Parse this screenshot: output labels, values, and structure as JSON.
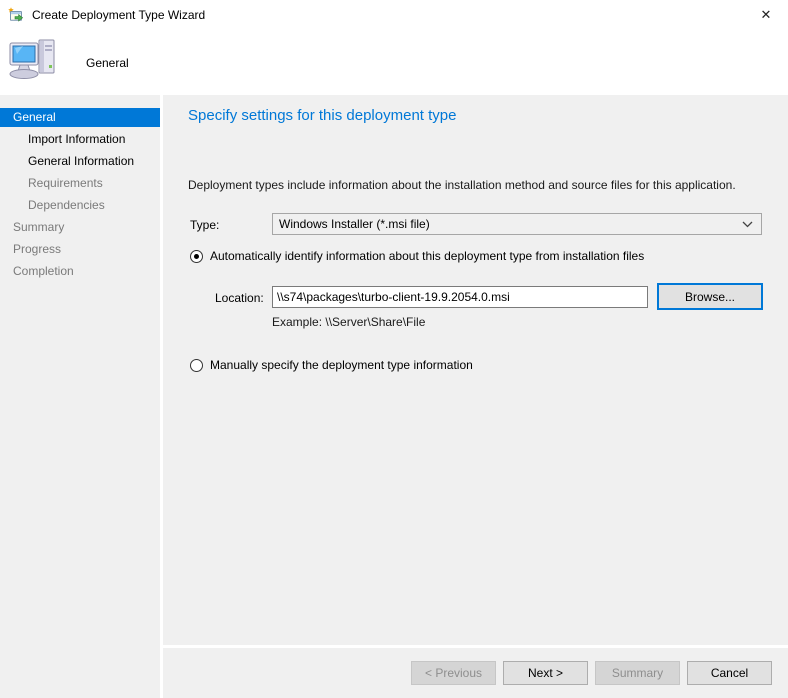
{
  "window": {
    "title": "Create Deployment Type Wizard",
    "close_glyph": "✕"
  },
  "banner": {
    "page_label": "General"
  },
  "sidebar": {
    "items": [
      {
        "label": "General",
        "state": "selected",
        "indent": false
      },
      {
        "label": "Import Information",
        "state": "enabled",
        "indent": true
      },
      {
        "label": "General Information",
        "state": "enabled",
        "indent": true
      },
      {
        "label": "Requirements",
        "state": "disabled",
        "indent": true
      },
      {
        "label": "Dependencies",
        "state": "disabled",
        "indent": true
      },
      {
        "label": "Summary",
        "state": "disabled",
        "indent": false
      },
      {
        "label": "Progress",
        "state": "disabled",
        "indent": false
      },
      {
        "label": "Completion",
        "state": "disabled",
        "indent": false
      }
    ]
  },
  "content": {
    "heading": "Specify settings for this deployment type",
    "description": "Deployment types include information about the installation method and source files for this application.",
    "type_label": "Type:",
    "type_value": "Windows Installer (*.msi file)",
    "auto_radio_label": "Automatically identify information about this deployment type from installation files",
    "auto_radio_selected": true,
    "location_label": "Location:",
    "location_value": "\\\\s74\\packages\\turbo-client-19.9.2054.0.msi",
    "browse_label": "Browse...",
    "location_example": "Example: \\\\Server\\Share\\File",
    "manual_radio_label": "Manually specify the deployment type information",
    "manual_radio_selected": false
  },
  "footer": {
    "buttons": [
      {
        "label": "< Previous",
        "enabled": false
      },
      {
        "label": "Next >",
        "enabled": true
      },
      {
        "label": "Summary",
        "enabled": false
      },
      {
        "label": "Cancel",
        "enabled": true
      }
    ]
  },
  "colors": {
    "accent": "#0078d7",
    "surface": "#f0f0f0",
    "heading_blue": "#0078d7"
  }
}
